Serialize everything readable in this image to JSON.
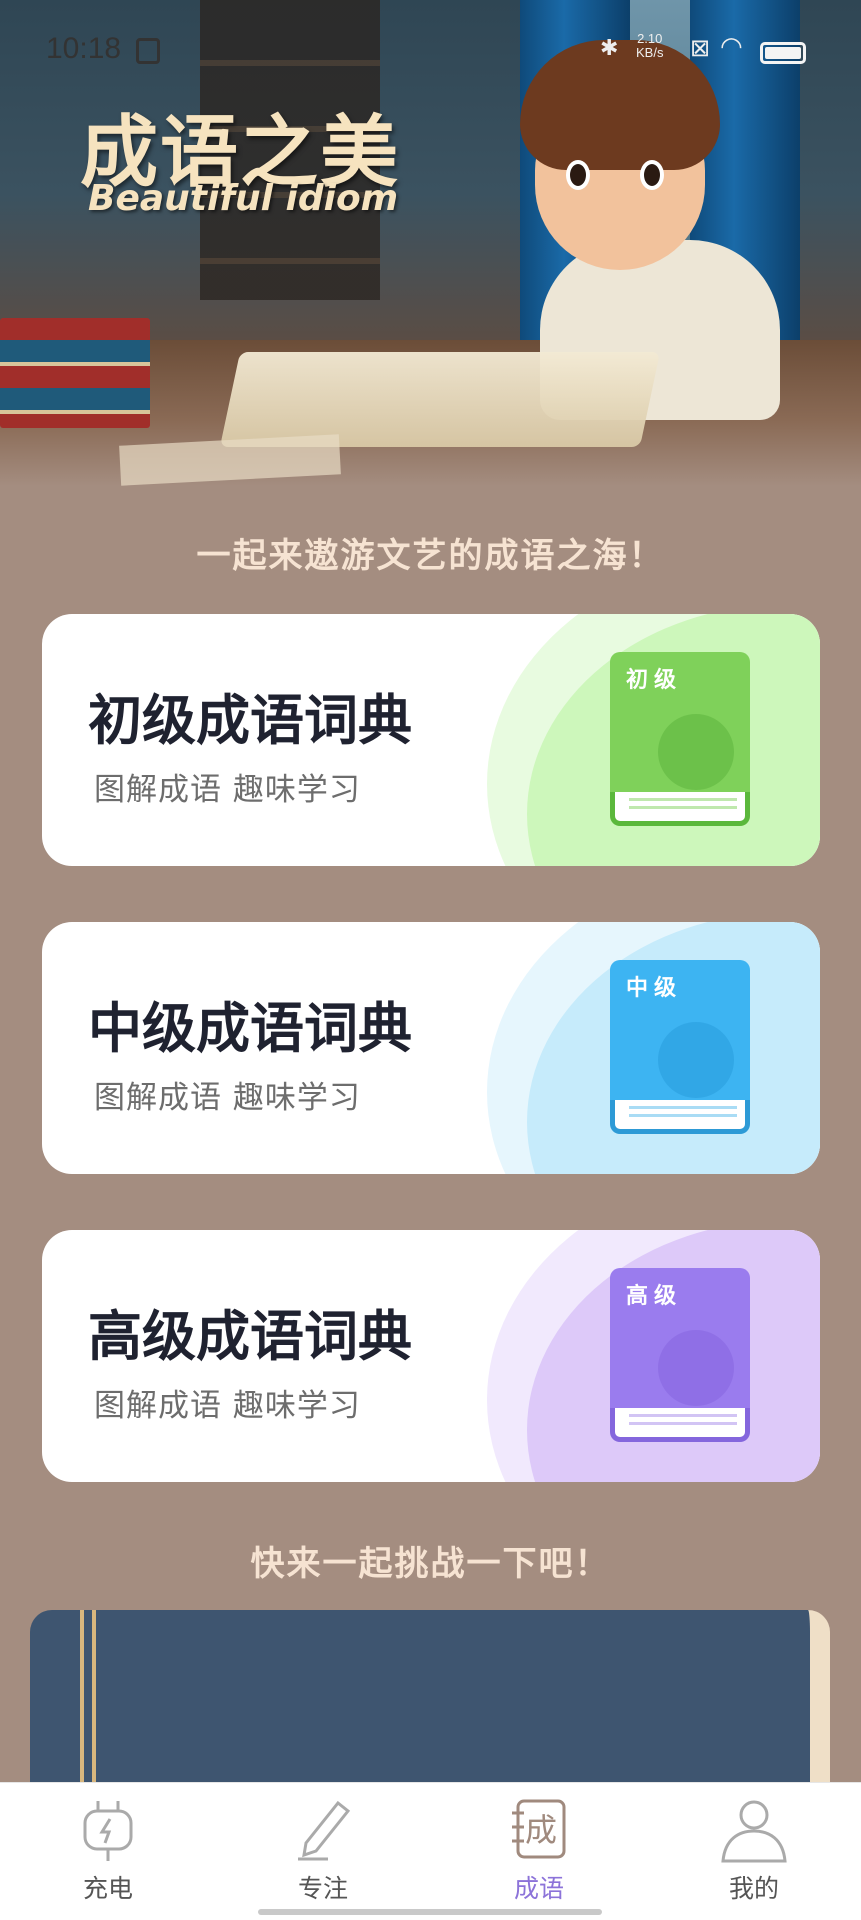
{
  "status_bar": {
    "time": "10:18",
    "speed_value": "2.10",
    "speed_unit": "KB/s"
  },
  "hero": {
    "title": "成语之美",
    "subtitle": "Beautiful idiom"
  },
  "section1_title": "一起来遨游文艺的成语之海！",
  "cards": [
    {
      "title": "初级成语词典",
      "subtitle": "图解成语 趣味学习",
      "book_label": "初级",
      "accent": "#7fd15a",
      "blob": "#cdf7bb"
    },
    {
      "title": "中级成语词典",
      "subtitle": "图解成语 趣味学习",
      "book_label": "中级",
      "accent": "#3db4f2",
      "blob": "#c6ebfb"
    },
    {
      "title": "高级成语词典",
      "subtitle": "图解成语 趣味学习",
      "book_label": "高级",
      "accent": "#9a7cee",
      "blob": "#ddc9f9"
    }
  ],
  "section2_title": "快来一起挑战一下吧！",
  "tabbar": {
    "tabs": [
      {
        "label": "充电",
        "icon": "plug-icon",
        "active": false
      },
      {
        "label": "专注",
        "icon": "pen-icon",
        "active": false
      },
      {
        "label": "成语",
        "icon": "idiom-book-icon",
        "active": true,
        "icon_char": "成"
      },
      {
        "label": "我的",
        "icon": "person-icon",
        "active": false
      }
    ],
    "active_color": "#8c73d9"
  }
}
